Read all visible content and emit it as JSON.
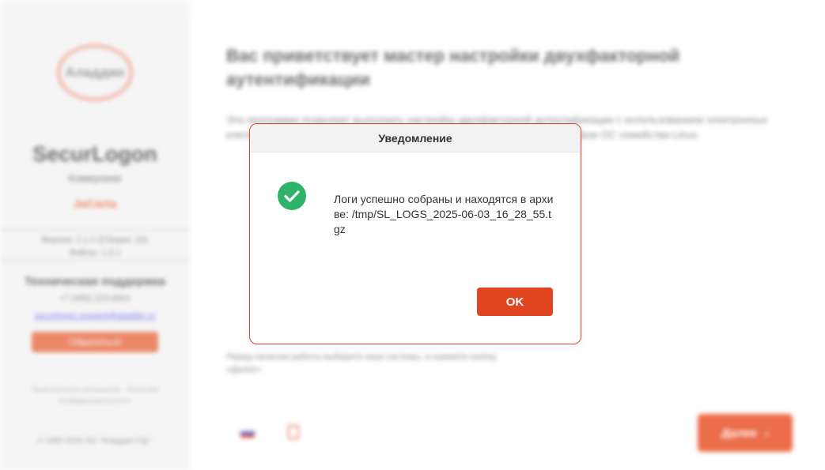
{
  "background": {
    "sidebar": {
      "logo_text": "Аладдин",
      "product_name": "SecurLogon",
      "edition": "Коммуники",
      "brand": "JaCarta",
      "version_line1": "Версия: 2.1.0 (Сборка: 20)",
      "version_line2": "Файлы: 1.0.1",
      "support_title": "Техническая поддержка",
      "support_phone": "+7 (495) 223-0001",
      "support_email": "securlogon.support@aladdin.ru",
      "support_button": "Обратиться",
      "copy_note": "Лицензионное соглашение · Политика конфиденциальности",
      "copyright": "© 1995-2025 АО \"Аладдин Р.Д.\""
    },
    "main": {
      "title": "Вас приветствует мастер настройки двухфакторной аутентификации",
      "intro": "Эта программа позволяет выполнить настройку двухфакторной аутентификации с использованием электронных ключей и смарт-карт для доменных пользователей в инфраструктуре на базе ОС семейства Linux.",
      "language_hint": "Перед началом работы выберите язык системы, и нажмите кнопку «Далее»",
      "next_button": "Далее",
      "next_icon": "chevron-right-icon",
      "flag_icon": "flag-ru-icon",
      "doc_icon": "document-icon"
    }
  },
  "dialog": {
    "title": "Уведомление",
    "icon": "success-check-icon",
    "message": "Логи успешно собраны и находятся в архиве: /tmp/SL_LOGS_2025-06-03_16_28_55.tgz",
    "ok_label": "OK"
  },
  "colors": {
    "accent": "#e14420",
    "success": "#2fb36a",
    "dialog_border": "#e0452a"
  }
}
